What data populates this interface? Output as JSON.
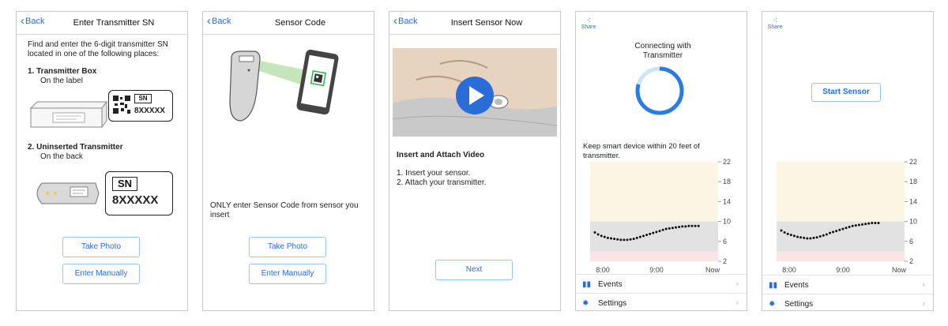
{
  "screens": [
    {
      "back": "Back",
      "title": "Enter Transmitter SN",
      "intro": "Find and enter the 6-digit transmitter SN located in one of the following places:",
      "item1_title": "1. Transmitter Box",
      "item1_sub": "On the label",
      "item1_sn": "SN",
      "item1_code": "8XXXXX",
      "item2_title": "2. Uninserted Transmitter",
      "item2_sub": "On the back",
      "item2_sn": "SN",
      "item2_code": "8XXXXX",
      "take_photo": "Take Photo",
      "enter_manually": "Enter Manually"
    },
    {
      "back": "Back",
      "title": "Sensor Code",
      "note": "ONLY enter Sensor Code from sensor you insert",
      "take_photo": "Take Photo",
      "enter_manually": "Enter Manually"
    },
    {
      "back": "Back",
      "title": "Insert Sensor Now",
      "video_title": "Insert and Attach Video",
      "step1": "1. Insert your sensor.",
      "step2": "2. Attach your transmitter.",
      "next": "Next"
    },
    {
      "share": "Share",
      "status": "Connecting with Transmitter",
      "keep": "Keep smart device within 20 feet of transmitter.",
      "events": "Events",
      "settings": "Settings"
    },
    {
      "share": "Share",
      "start": "Start Sensor",
      "events": "Events",
      "settings": "Settings"
    }
  ],
  "chart_data": [
    {
      "type": "scatter",
      "x_tick_labels": [
        "8:00",
        "9:00",
        "Now"
      ],
      "y_ticks": [
        22,
        18,
        14,
        10,
        6,
        2
      ],
      "ylim": [
        2,
        22
      ],
      "bands": [
        {
          "from": 10,
          "to": 22,
          "color": "#fbf6e3"
        },
        {
          "from": 4,
          "to": 10,
          "color": "#e2e2e2"
        },
        {
          "from": 2,
          "to": 4,
          "color": "#fbe4e4"
        }
      ],
      "x": [
        0,
        4,
        8,
        12,
        16,
        20,
        24,
        28,
        32,
        36,
        40,
        44,
        48,
        52,
        56,
        60,
        64,
        68,
        72,
        76,
        80,
        84,
        88,
        92,
        96,
        100,
        104,
        108,
        112,
        116,
        120,
        124,
        128
      ],
      "y": [
        7.8,
        7.4,
        7.1,
        6.9,
        6.7,
        6.6,
        6.5,
        6.4,
        6.3,
        6.3,
        6.3,
        6.4,
        6.5,
        6.7,
        6.9,
        7.1,
        7.3,
        7.5,
        7.7,
        7.9,
        8.1,
        8.3,
        8.5,
        8.6,
        8.7,
        8.8,
        8.9,
        9.0,
        9.0,
        9.1,
        9.1,
        9.1,
        9.1
      ],
      "x_range": [
        0,
        160
      ]
    },
    {
      "type": "scatter",
      "x_tick_labels": [
        "8:00",
        "9:00",
        "Now"
      ],
      "y_ticks": [
        22,
        18,
        14,
        10,
        6,
        2
      ],
      "ylim": [
        2,
        22
      ],
      "bands": [
        {
          "from": 10,
          "to": 22,
          "color": "#fbf6e3"
        },
        {
          "from": 4,
          "to": 10,
          "color": "#e2e2e2"
        },
        {
          "from": 2,
          "to": 4,
          "color": "#fbe4e4"
        }
      ],
      "x": [
        0,
        4,
        8,
        12,
        16,
        20,
        24,
        28,
        32,
        36,
        40,
        44,
        48,
        52,
        56,
        60,
        64,
        68,
        72,
        76,
        80,
        84,
        88,
        92,
        96,
        100,
        104,
        108,
        112,
        116,
        120
      ],
      "y": [
        8.2,
        7.8,
        7.5,
        7.3,
        7.1,
        6.9,
        6.8,
        6.7,
        6.6,
        6.6,
        6.7,
        6.8,
        7.0,
        7.2,
        7.4,
        7.7,
        7.9,
        8.1,
        8.3,
        8.5,
        8.7,
        8.9,
        9.1,
        9.2,
        9.3,
        9.4,
        9.5,
        9.6,
        9.7,
        9.7,
        9.7
      ],
      "x_range": [
        0,
        160
      ]
    }
  ]
}
